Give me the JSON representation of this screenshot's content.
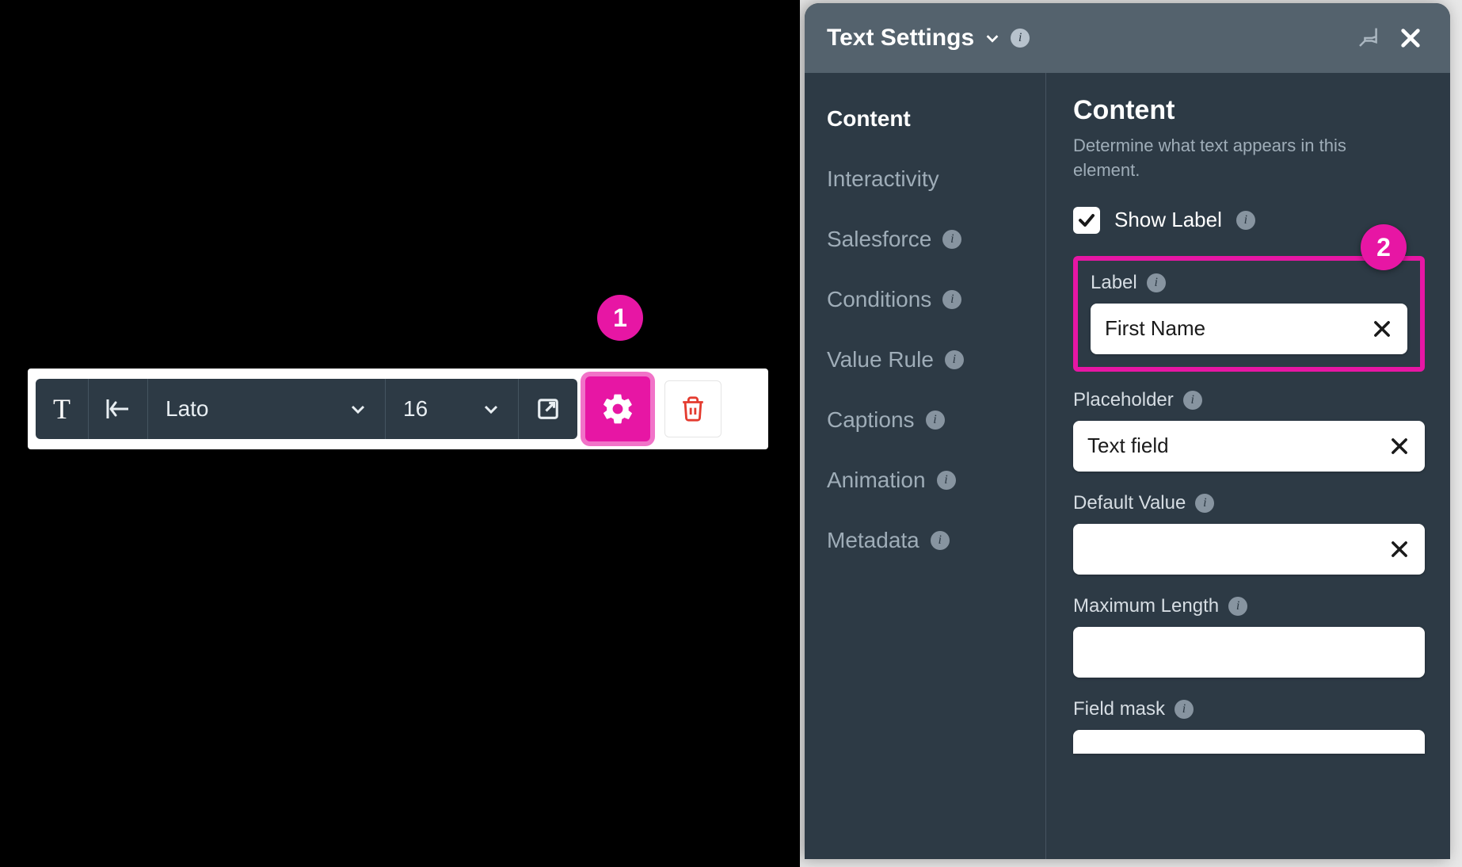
{
  "toolbar": {
    "font": "Lato",
    "size": "16"
  },
  "markers": {
    "one": "1",
    "two": "2"
  },
  "panel": {
    "title": "Text Settings",
    "nav": [
      {
        "label": "Content",
        "info": false,
        "active": true
      },
      {
        "label": "Interactivity",
        "info": false,
        "active": false
      },
      {
        "label": "Salesforce",
        "info": true,
        "active": false
      },
      {
        "label": "Conditions",
        "info": true,
        "active": false
      },
      {
        "label": "Value Rule",
        "info": true,
        "active": false
      },
      {
        "label": "Captions",
        "info": true,
        "active": false
      },
      {
        "label": "Animation",
        "info": true,
        "active": false
      },
      {
        "label": "Metadata",
        "info": true,
        "active": false
      }
    ],
    "content": {
      "heading": "Content",
      "description": "Determine what text appears in this element.",
      "show_label_text": "Show Label",
      "show_label_checked": true,
      "fields": {
        "label": {
          "title": "Label",
          "value": "First Name"
        },
        "placeholder": {
          "title": "Placeholder",
          "value": "Text field"
        },
        "default_value": {
          "title": "Default Value",
          "value": ""
        },
        "maximum_length": {
          "title": "Maximum Length",
          "value": ""
        },
        "field_mask": {
          "title": "Field mask",
          "value": ""
        }
      }
    }
  }
}
